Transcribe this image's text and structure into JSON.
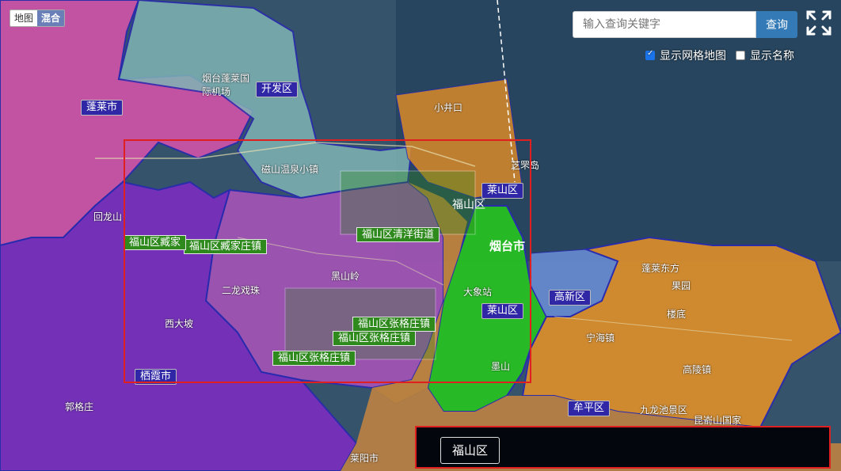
{
  "map_type": {
    "map_label": "地图",
    "hybrid_label": "混合"
  },
  "search": {
    "placeholder": "输入查询关键字",
    "button_label": "查询"
  },
  "options": {
    "grid_map_label": "显示网格地图",
    "grid_map_checked": true,
    "show_name_label": "显示名称",
    "show_name_checked": false
  },
  "districts": [
    "蓬莱市",
    "开发区",
    "莱山区",
    "高新区",
    "牟平区",
    "栖霞市",
    "福山区",
    "莱山区",
    "烟台市"
  ],
  "grid_labels": [
    "福山区清洋街道",
    "福山区臧家庄镇",
    "福山区张格庄镇",
    "福山区张格庄镇",
    "福山区臧家",
    "福山区张格庄镇"
  ],
  "places": [
    "烟台蓬莱国际机场",
    "磁山温泉小镇",
    "小井口",
    "芝罘岛",
    "黑山岭",
    "二龙戏珠",
    "西大坡",
    "蓬莱东方",
    "果园",
    "楼底",
    "高陵镇",
    "昆嵛山国家",
    "九龙池景区",
    "宁海镇",
    "莱阳市",
    "郭格庄",
    "大象站",
    "回龙山",
    "墨山"
  ],
  "selected_panel": {
    "label": "福山区"
  },
  "colors": {
    "grid_green": "#2f8a1e",
    "district_tag": "#2f27a6",
    "highlight": "#e02020",
    "search_button": "#337ab7"
  }
}
